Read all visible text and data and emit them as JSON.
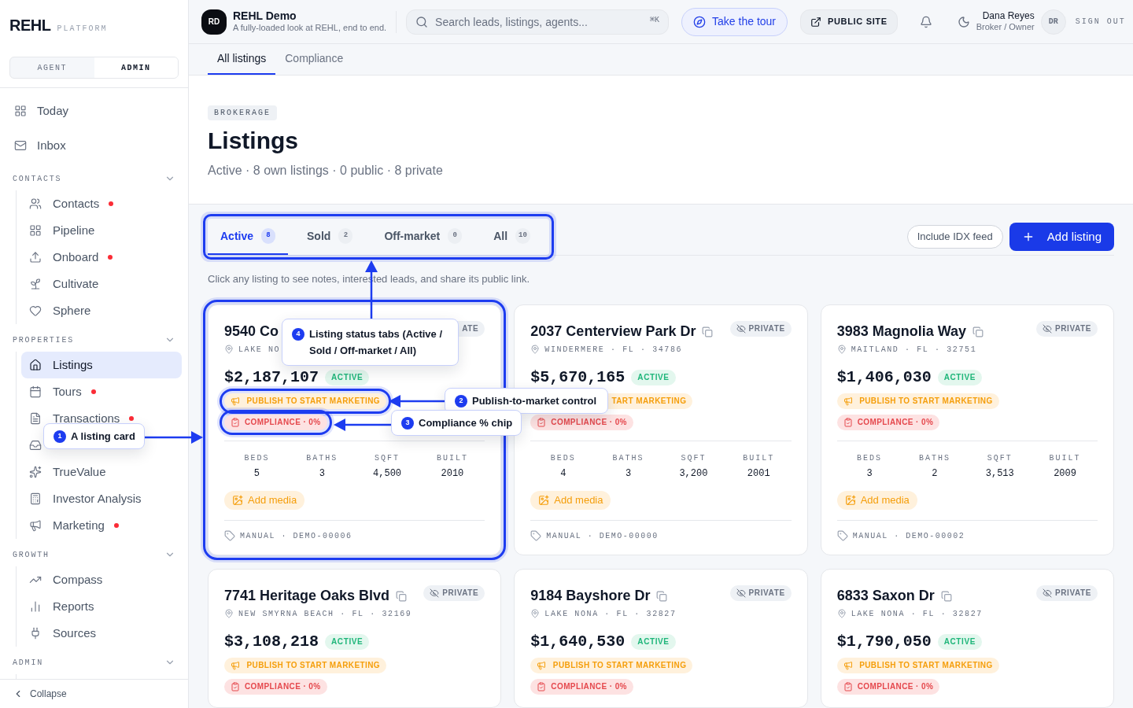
{
  "sidebar": {
    "logo": "REHL",
    "logo_sub": "PLATFORM",
    "role_switch": [
      {
        "label": "AGENT",
        "selected": false
      },
      {
        "label": "ADMIN",
        "selected": true
      }
    ],
    "top_items": [
      {
        "label": "Today",
        "selected": false
      },
      {
        "label": "Inbox",
        "selected": false
      }
    ],
    "sections": [
      {
        "title": "CONTACTS",
        "expanded": true,
        "items": [
          {
            "label": "Contacts",
            "alert": true,
            "selected": false
          },
          {
            "label": "Pipeline",
            "alert": false,
            "selected": false
          },
          {
            "label": "Onboard",
            "alert": true,
            "selected": false
          },
          {
            "label": "Cultivate",
            "alert": false,
            "selected": false
          },
          {
            "label": "Sphere",
            "alert": false,
            "selected": false
          }
        ]
      },
      {
        "title": "PROPERTIES",
        "expanded": true,
        "items": [
          {
            "label": "Listings",
            "alert": false,
            "selected": true
          },
          {
            "label": "Tours",
            "alert": true,
            "selected": false
          },
          {
            "label": "Transactions",
            "alert": true,
            "selected": false
          },
          {
            "alert": false,
            "selected": false
          },
          {
            "label": "TrueValue",
            "alert": false,
            "selected": false
          },
          {
            "label": "Investor Analysis",
            "alert": false,
            "selected": false
          },
          {
            "label": "Marketing",
            "alert": true,
            "selected": false
          }
        ]
      },
      {
        "title": "GROWTH",
        "expanded": true,
        "items": [
          {
            "label": "Compass",
            "alert": false,
            "selected": false
          },
          {
            "label": "Reports",
            "alert": false,
            "selected": false
          },
          {
            "label": "Sources",
            "alert": false,
            "selected": false
          }
        ]
      },
      {
        "title": "ADMIN",
        "expanded": true
      }
    ],
    "collapse": "Collapse"
  },
  "header": {
    "avatar": "RD",
    "title": "REHL Demo",
    "subtitle": "A fully-loaded look at REHL, end to end.",
    "search": {
      "placeholder": "Search leads, listings, agents...",
      "shortcut": "⌘K"
    },
    "tour_button": "Take the tour",
    "public_site": "PUBLIC SITE",
    "user": {
      "name": "Dana Reyes",
      "role": "Broker / Owner",
      "initials": "DR"
    },
    "sign_out": "SIGN OUT"
  },
  "subtabs": [
    {
      "label": "All listings",
      "selected": true
    },
    {
      "label": "Compliance",
      "selected": false
    }
  ],
  "page": {
    "eyebrow": "BROKERAGE",
    "title": "Listings",
    "summary": "Active · 8 own listings · 0 public · 8 private"
  },
  "status_tabs": {
    "highlighted": true,
    "items": [
      {
        "label": "Active",
        "count": "8",
        "selected": true
      },
      {
        "label": "Sold",
        "count": "2",
        "selected": false
      },
      {
        "label": "Off-market",
        "count": "0",
        "selected": false
      },
      {
        "label": "All",
        "count": "10",
        "selected": false
      }
    ]
  },
  "idx_button": "Include IDX feed",
  "add_button": "Add listing",
  "hint": "Click any listing to see notes, interested leads, and share its public link.",
  "listings": [
    {
      "title": "9540 Co",
      "location": "LAKE NO",
      "visibility": "ATE",
      "price": "$2,187,107",
      "status": "ACTIVE",
      "highlighted": true,
      "publish": {
        "text": "PUBLISH TO START MARKETING",
        "highlighted": true
      },
      "compliance": {
        "text": "COMPLIANCE · 0%",
        "highlighted": true
      },
      "stats": [
        {
          "label": "BEDS",
          "value": "5"
        },
        {
          "label": "BATHS",
          "value": "3"
        },
        {
          "label": "SQFT",
          "value": "4,500"
        },
        {
          "label": "BUILT",
          "value": "2010"
        }
      ],
      "media_button": "Add media",
      "source": "MANUAL · DEMO-00006"
    },
    {
      "title": "2037 Centerview Park Dr",
      "location": "WINDERMERE · FL · 34786",
      "visibility": "PRIVATE",
      "price": "$5,670,165",
      "status": "ACTIVE",
      "highlighted": false,
      "publish": {
        "text": "TART MARKETING",
        "highlighted": false
      },
      "compliance": {
        "text": "COMPLIANCE · 0%",
        "highlighted": false
      },
      "stats": [
        {
          "label": "BEDS",
          "value": "4"
        },
        {
          "label": "BATHS",
          "value": "3"
        },
        {
          "label": "SQFT",
          "value": "3,200"
        },
        {
          "label": "BUILT",
          "value": "2001"
        }
      ],
      "media_button": "Add media",
      "source": "MANUAL · DEMO-00000"
    },
    {
      "title": "3983 Magnolia Way",
      "location": "MAITLAND · FL · 32751",
      "visibility": "PRIVATE",
      "price": "$1,406,030",
      "status": "ACTIVE",
      "highlighted": false,
      "publish": {
        "text": "PUBLISH TO START MARKETING",
        "highlighted": false
      },
      "compliance": {
        "text": "COMPLIANCE · 0%",
        "highlighted": false
      },
      "stats": [
        {
          "label": "BEDS",
          "value": "3"
        },
        {
          "label": "BATHS",
          "value": "2"
        },
        {
          "label": "SQFT",
          "value": "3,513"
        },
        {
          "label": "BUILT",
          "value": "2009"
        }
      ],
      "media_button": "Add media",
      "source": "MANUAL · DEMO-00002"
    },
    {
      "title": "7741 Heritage Oaks Blvd",
      "location": "NEW SMYRNA BEACH · FL · 32169",
      "visibility": "PRIVATE",
      "price": "$3,108,218",
      "status": "ACTIVE",
      "highlighted": false,
      "publish": {
        "text": "PUBLISH TO START MARKETING",
        "highlighted": false
      },
      "compliance": {
        "text": "COMPLIANCE · 0%",
        "highlighted": false
      }
    },
    {
      "title": "9184 Bayshore Dr",
      "location": "LAKE NONA · FL · 32827",
      "visibility": "PRIVATE",
      "price": "$1,640,530",
      "status": "ACTIVE",
      "highlighted": false,
      "publish": {
        "text": "PUBLISH TO START MARKETING",
        "highlighted": false
      },
      "compliance": {
        "text": "COMPLIANCE · 0%",
        "highlighted": false
      }
    },
    {
      "title": "6833 Saxon Dr",
      "location": "LAKE NONA · FL · 32827",
      "visibility": "PRIVATE",
      "price": "$1,790,050",
      "status": "ACTIVE",
      "highlighted": false,
      "publish": {
        "text": "PUBLISH TO START MARKETING",
        "highlighted": false
      },
      "compliance": {
        "text": "COMPLIANCE · 0%",
        "highlighted": false
      }
    }
  ],
  "tour_callouts": [
    {
      "number": "4",
      "text": "Listing status tabs (Active / Sold / Off-market / All)"
    },
    {
      "number": "2",
      "text": "Publish-to-market control"
    },
    {
      "number": "3",
      "text": "Compliance % chip"
    },
    {
      "number": "1",
      "text": "A listing card"
    }
  ]
}
